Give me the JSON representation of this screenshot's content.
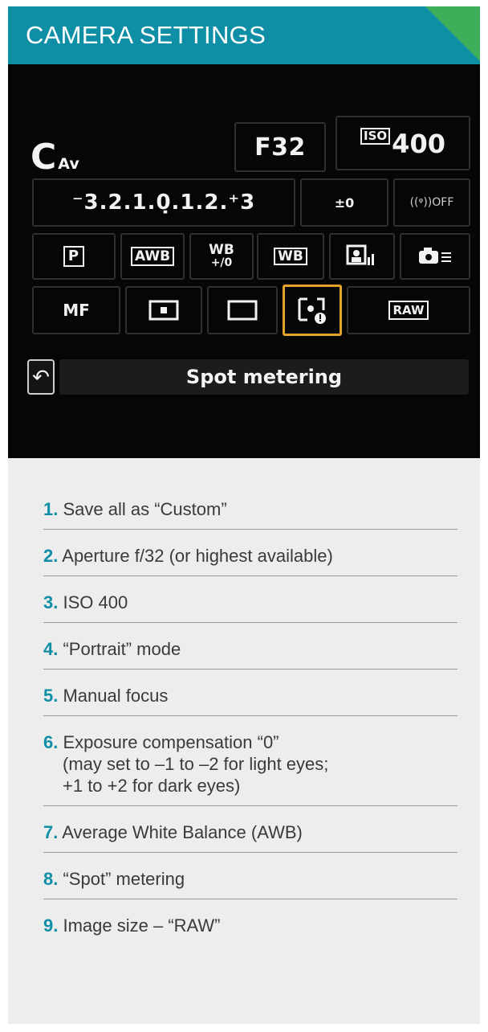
{
  "header": {
    "title": "CAMERA SETTINGS"
  },
  "lcd": {
    "mode_c": "C",
    "mode_av": "Av",
    "aperture": "F32",
    "iso_badge": "ISO",
    "iso_value": "400",
    "exposure_scale": "⁻3.2.1.0̣.1.2.⁺3",
    "fec_icon": "⚡±",
    "fec_value": "±0",
    "wifi": "((ᵠ))OFF",
    "picture_style": "P",
    "awb": "AWB",
    "wb_shift": "WB",
    "wb_shift_sub": "+/0",
    "wb_bracket": "WB",
    "mf": "MF",
    "raw": "RAW",
    "status": "Spot metering",
    "back_icon": "↶"
  },
  "list": {
    "items": [
      {
        "num": "1.",
        "text": "Save all as “Custom”"
      },
      {
        "num": "2.",
        "text": "Aperture f/32 (or highest available)"
      },
      {
        "num": "3.",
        "text": "ISO 400"
      },
      {
        "num": "4.",
        "text": "“Portrait” mode"
      },
      {
        "num": "5.",
        "text": "Manual focus"
      },
      {
        "num": "6.",
        "text": "Exposure compensation “0”",
        "line2": "(may set to –1 to –2 for light eyes;",
        "line3": "+1 to +2 for dark eyes)"
      },
      {
        "num": "7.",
        "text": "Average White Balance (AWB)"
      },
      {
        "num": "8.",
        "text": "“Spot” metering"
      },
      {
        "num": "9.",
        "text": "Image size – “RAW”"
      }
    ]
  },
  "colors": {
    "accent": "#0f8fa6",
    "header_corner": "#3fae5a",
    "selection": "#e4a42a",
    "panel": "#ededee"
  }
}
